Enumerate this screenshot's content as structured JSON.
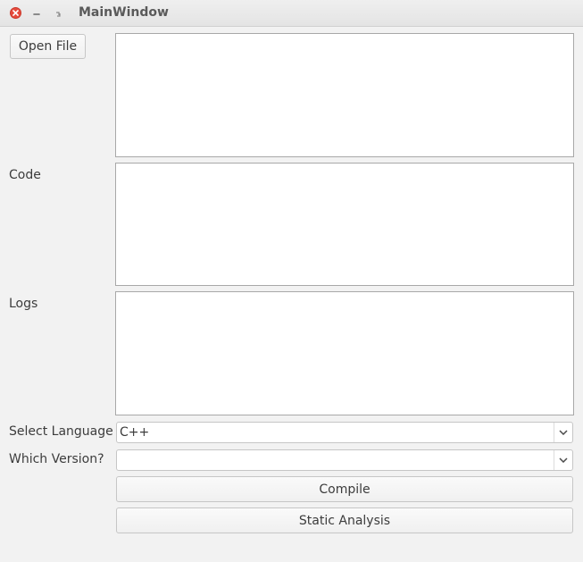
{
  "window": {
    "title": "MainWindow"
  },
  "toolbar": {
    "open_file_label": "Open File"
  },
  "labels": {
    "code": "Code",
    "logs": "Logs",
    "select_language": "Select Language",
    "which_version": "Which Version?"
  },
  "language_select": {
    "selected": "C++"
  },
  "version_select": {
    "selected": ""
  },
  "actions": {
    "compile_label": "Compile",
    "static_analysis_label": "Static Analysis"
  },
  "icons": {
    "close": "close-icon",
    "minimize": "minimize-icon",
    "maximize": "maximize-icon",
    "dropdown": "chevron-down-icon"
  },
  "colors": {
    "close_button": "#e64a3c",
    "window_bg": "#f2f2f2"
  }
}
